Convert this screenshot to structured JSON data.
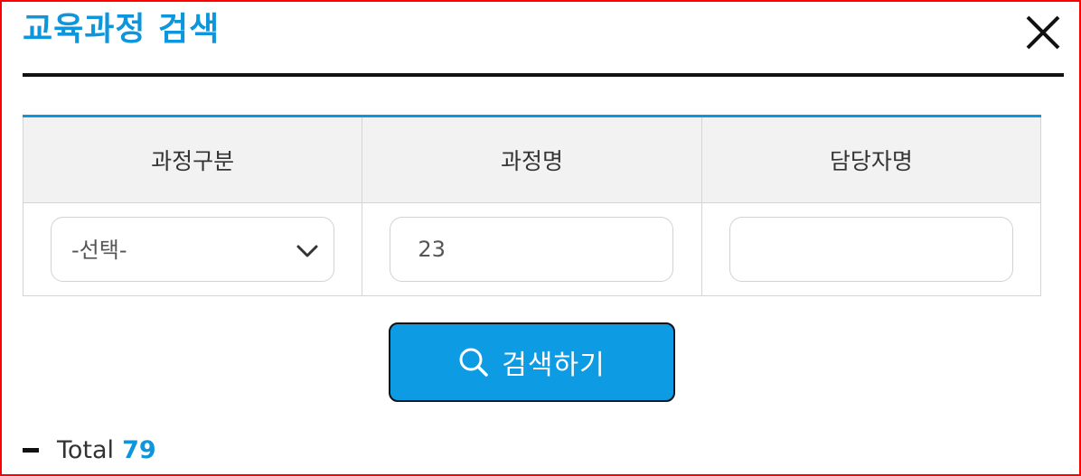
{
  "header": {
    "title": "교육과정 검색",
    "close_icon": "close-icon"
  },
  "colors": {
    "accent": "#0d96dc",
    "button": "#0d9be4",
    "frame_border": "#ff0000",
    "header_bg": "#f2f2f2"
  },
  "search_form": {
    "columns": [
      "과정구분",
      "과정명",
      "담당자명"
    ],
    "course_type": {
      "selected": "-선택-",
      "icon": "chevron-down-icon"
    },
    "course_name": {
      "value": "23"
    },
    "manager_name": {
      "value": ""
    }
  },
  "search_button": {
    "label": "검색하기",
    "icon": "search-icon"
  },
  "results": {
    "total_label": "Total",
    "total_count": "79"
  }
}
